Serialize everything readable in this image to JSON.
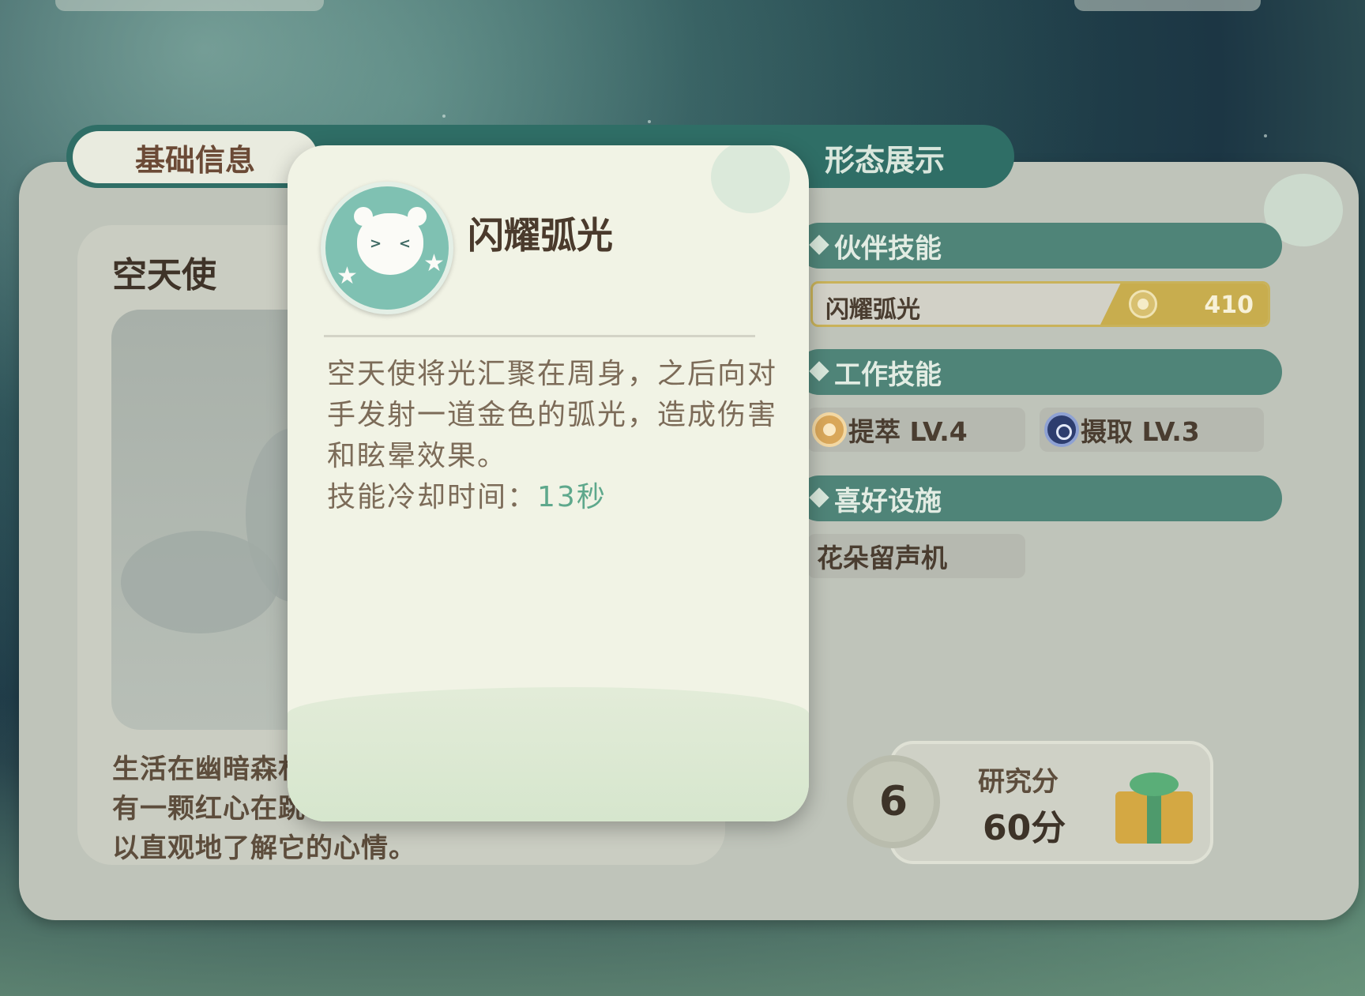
{
  "tabs": [
    {
      "label": "基础信息",
      "active": true
    },
    {
      "label": "形态展示",
      "active": false
    }
  ],
  "pet": {
    "name": "空天使",
    "description_lines": [
      "生活在幽暗森林",
      "有一颗红心在跳",
      "以直观地了解它的心情。"
    ]
  },
  "sections": {
    "partner_skill_header": "伙伴技能",
    "work_skill_header": "工作技能",
    "facility_header": "喜好设施"
  },
  "partner_skill": {
    "name": "闪耀弧光",
    "value": "410"
  },
  "work_skills": [
    {
      "label": "提萃 LV.4",
      "icon": "extract-icon"
    },
    {
      "label": "摄取 LV.3",
      "icon": "intake-icon"
    }
  ],
  "facility": {
    "label": "花朵留声机"
  },
  "research": {
    "level": "6",
    "label": "研究分",
    "value": "60分",
    "icon": "gift-icon"
  },
  "popup": {
    "title": "闪耀弧光",
    "icon": "bear-skill-icon",
    "desc_lines": [
      "空天使将光汇聚在周身，之后向对",
      "手发射一道金色的弧光，造成伤害",
      "和眩晕效果。"
    ],
    "cooldown_label": "技能冷却时间：",
    "cooldown_value": "13秒"
  },
  "colors": {
    "teal_header": "#4f8478",
    "tab_bar": "#2f6e66",
    "gold": "#c8ad4e",
    "cooldown_green": "#5ea88c"
  }
}
